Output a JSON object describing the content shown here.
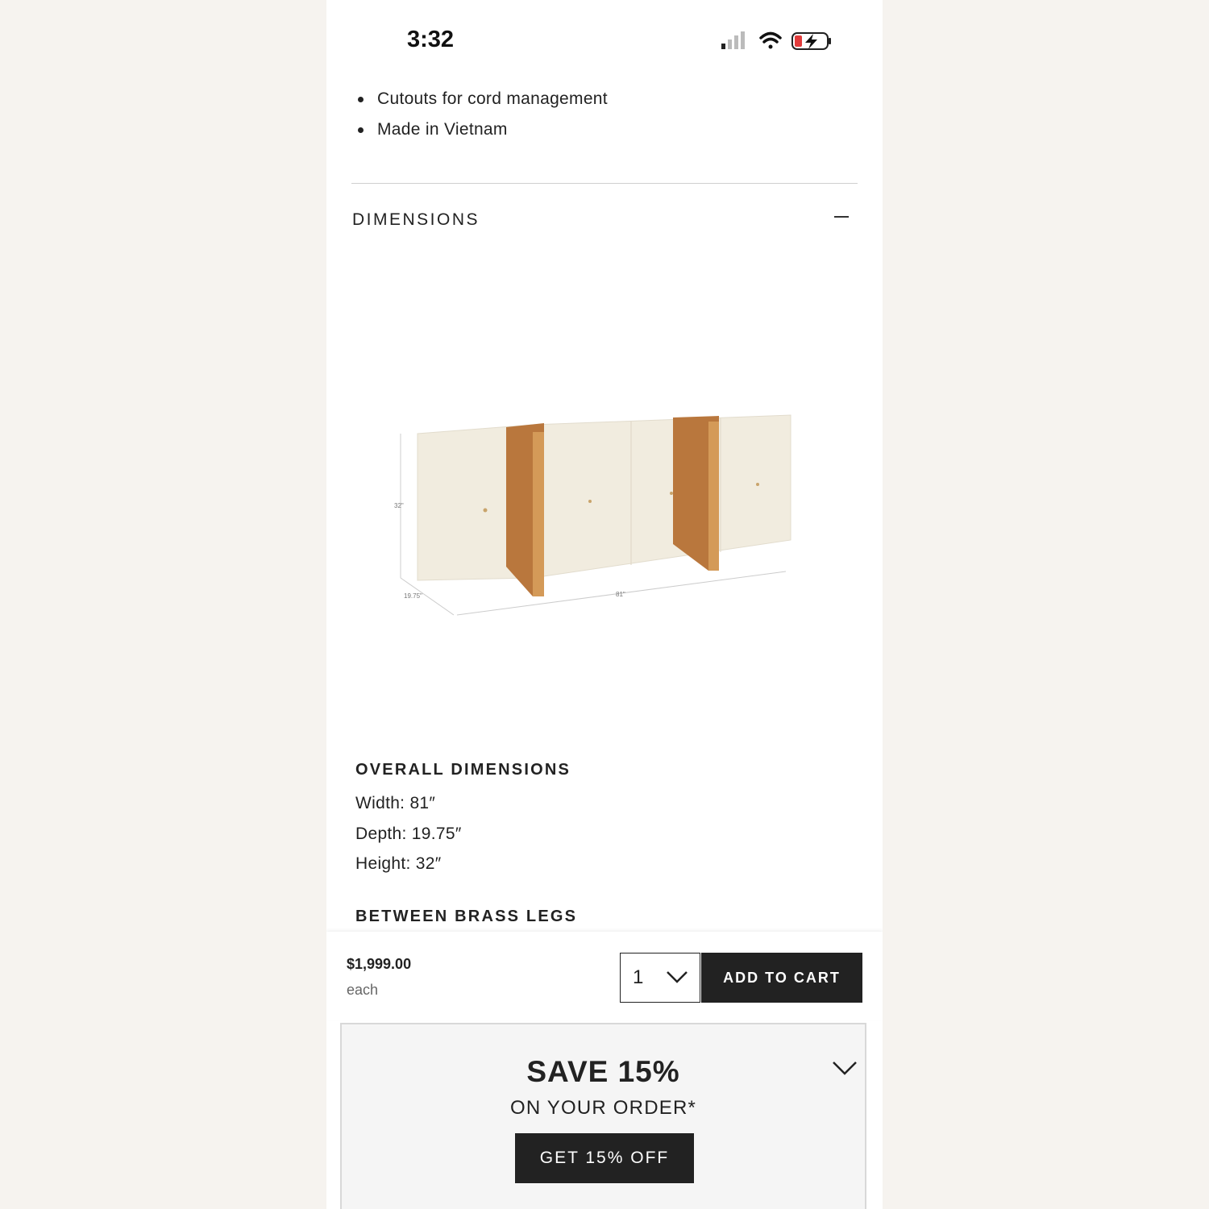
{
  "status_bar": {
    "time": "3:32"
  },
  "features": [
    "Cutouts for cord management",
    "Made in Vietnam"
  ],
  "dimensions_section": {
    "title": "DIMENSIONS",
    "image_labels": {
      "height": "32\"",
      "depth": "19.75\"",
      "width": "81\""
    }
  },
  "overall_dimensions": {
    "heading": "OVERALL DIMENSIONS",
    "width": "Width: 81″",
    "depth": "Depth: 19.75″",
    "height": "Height: 32″"
  },
  "between_brass_legs": {
    "heading": "BETWEEN BRASS LEGS"
  },
  "cart_bar": {
    "price": "$1,999.00",
    "unit": "each",
    "quantity": "1",
    "add_to_cart": "ADD TO CART"
  },
  "promo": {
    "title": "SAVE 15%",
    "subtitle": "ON YOUR ORDER*",
    "button": "GET 15% OFF"
  },
  "colors": {
    "page_background": "#f6f3ef",
    "dark": "#222222",
    "brass": "#c48a4e",
    "cabinet": "#f1ecdf"
  }
}
